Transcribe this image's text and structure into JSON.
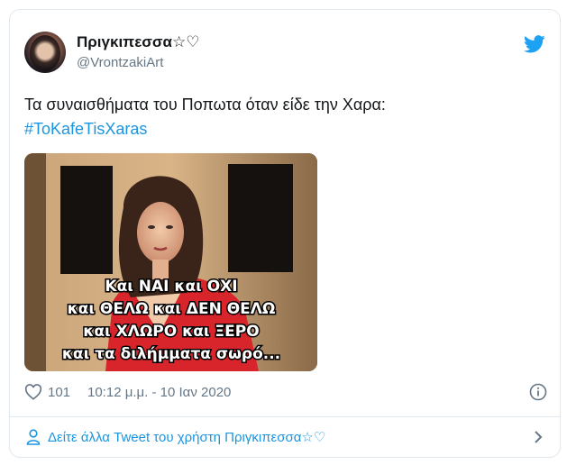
{
  "tweet": {
    "display_name": "Πριγκιπεσσα☆♡",
    "handle": "@VrontzakiArt",
    "text": "Τα συναισθήματα του Ποπωτα όταν είδε την Χαρα:",
    "hashtag": "#ToKafeTisXaras",
    "media_caption_lines": [
      "Και ΝΑΙ και ΟΧΙ",
      "και ΘΕΛΩ και ΔΕΝ ΘΕΛΩ",
      "και ΧΛΩΡΟ και ΞΕΡΟ",
      "και τα διλήμματα σωρό..."
    ],
    "like_count": "101",
    "timestamp": "10:12 μ.μ. - 10 Ιαν 2020",
    "footer_link": "Δείτε άλλα Tweet του χρήστη Πριγκιπεσσα☆♡"
  },
  "colors": {
    "link": "#1b95e0",
    "muted": "#657786",
    "border": "#e1e8ed",
    "twitter_blue": "#1da1f2"
  },
  "icons": {
    "brand": "twitter-bird-icon",
    "like": "heart-icon",
    "info": "info-icon",
    "person": "person-icon",
    "chevron": "chevron-right-icon"
  }
}
